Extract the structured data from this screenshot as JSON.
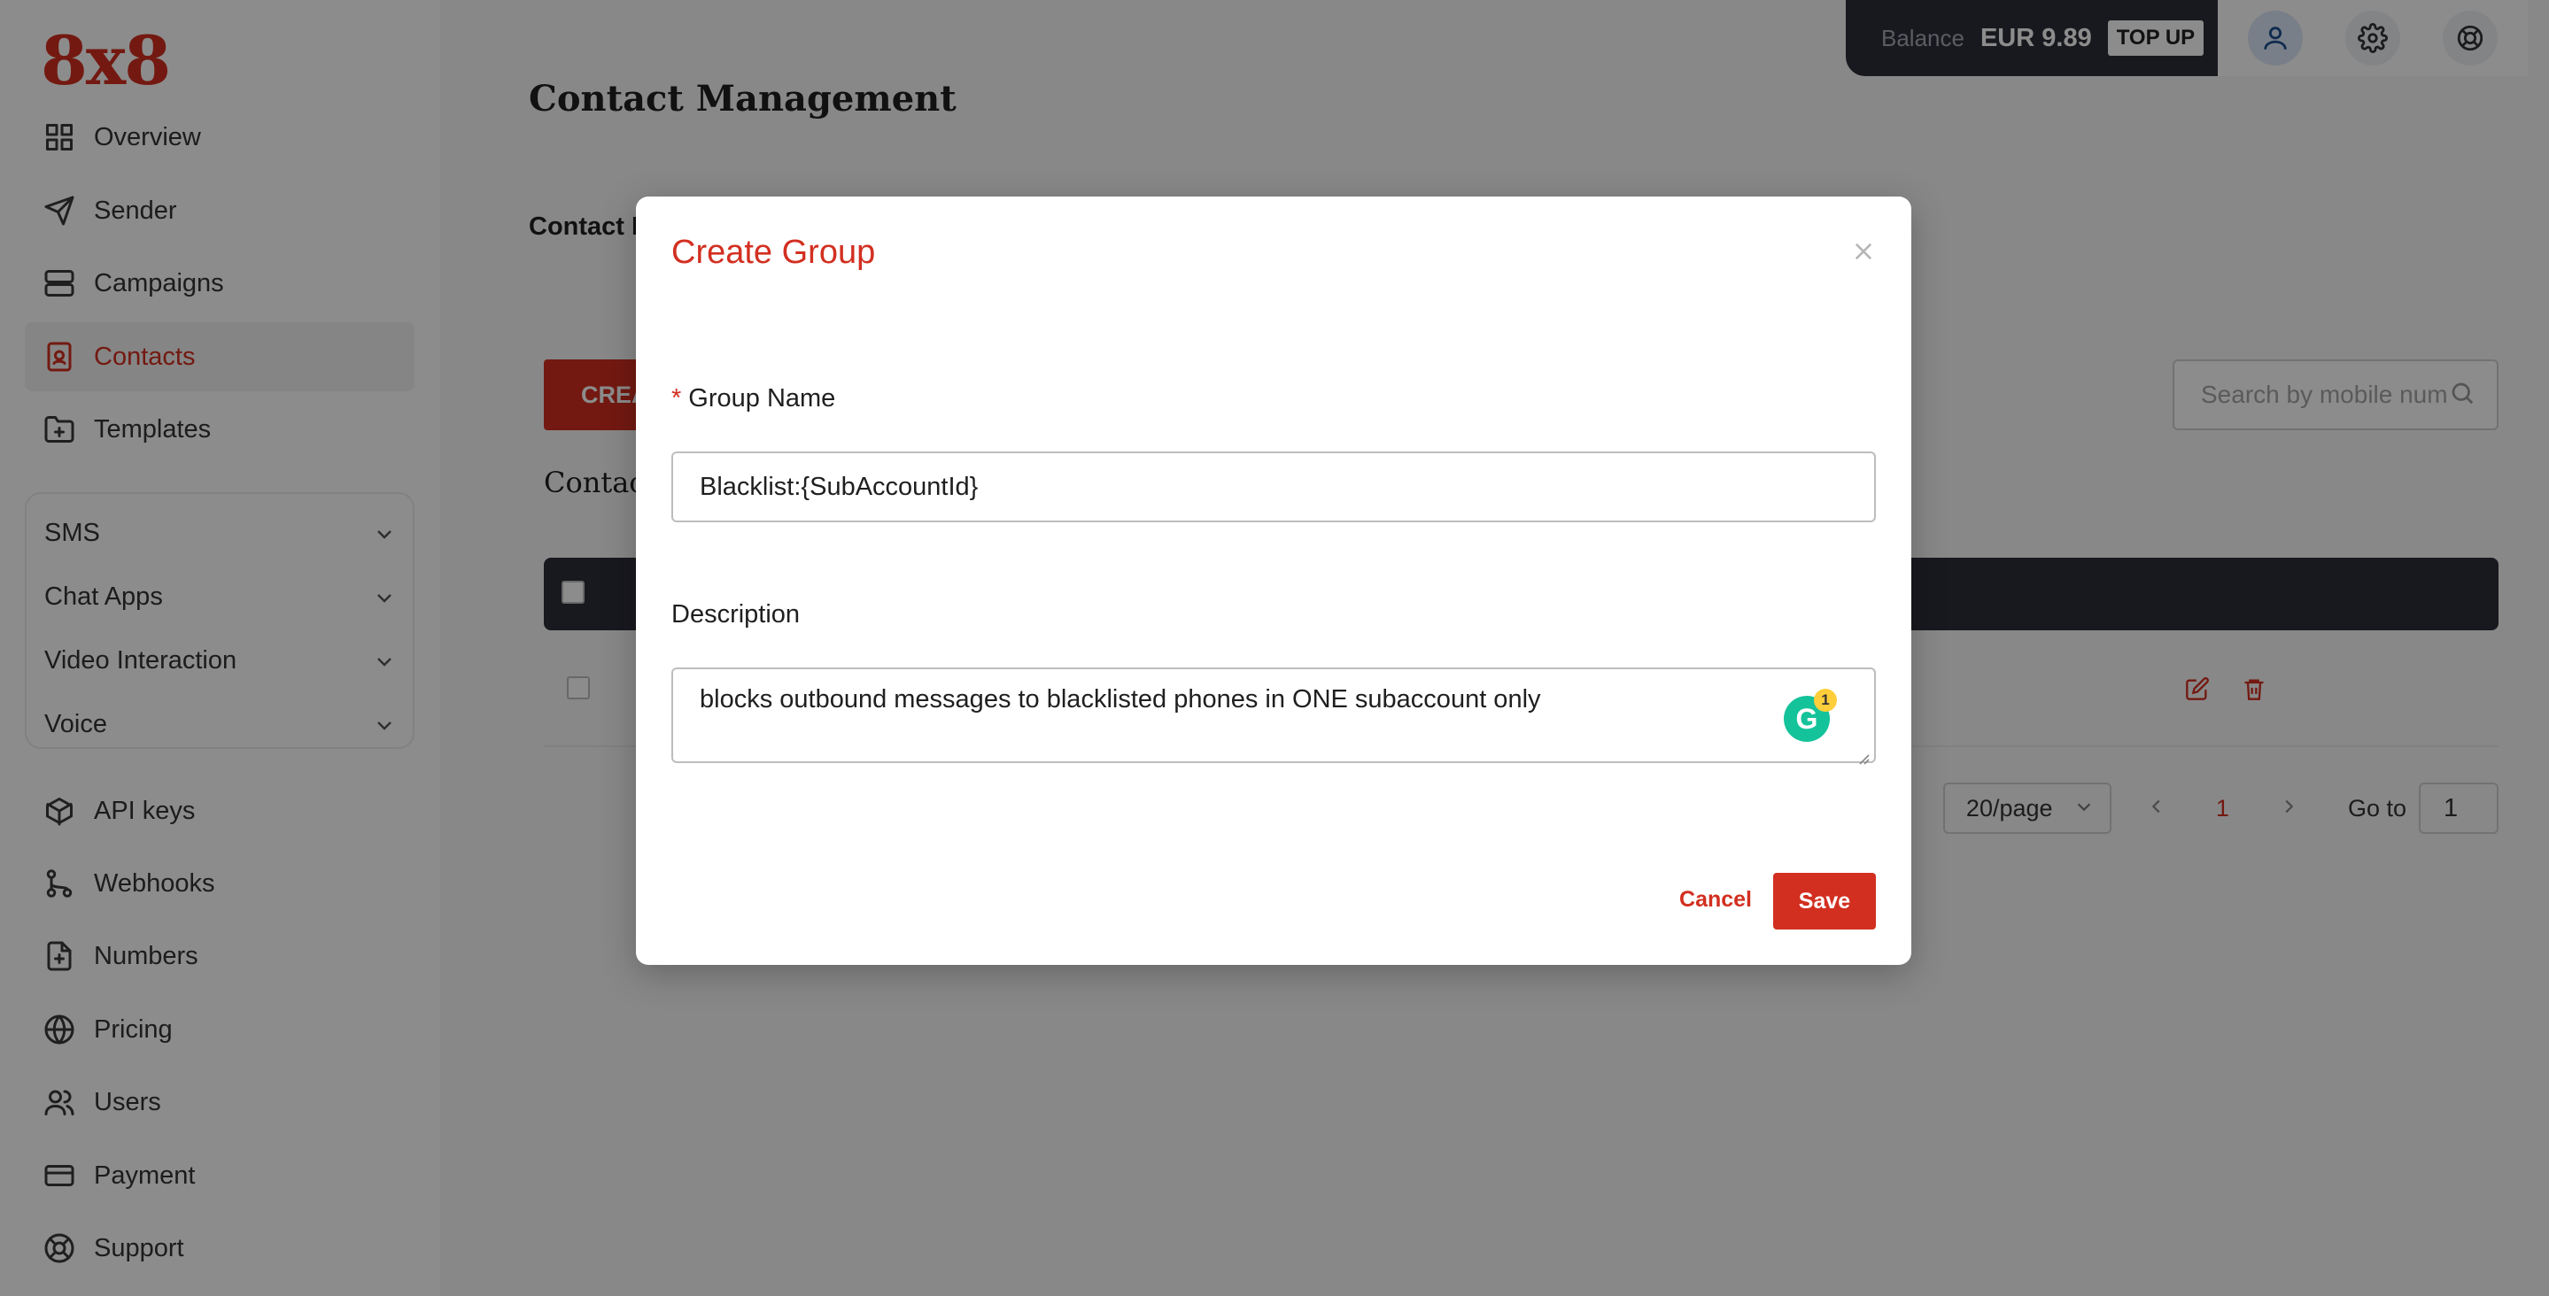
{
  "brand": {
    "logo_text": "8x8",
    "accent": "#d22f20",
    "dark": "#2d2d3a"
  },
  "sidebar": {
    "items": [
      {
        "label": "Overview",
        "icon": "grid-icon"
      },
      {
        "label": "Sender",
        "icon": "send-icon"
      },
      {
        "label": "Campaigns",
        "icon": "server-icon"
      },
      {
        "label": "Contacts",
        "icon": "contact-book-icon",
        "active": true
      },
      {
        "label": "Templates",
        "icon": "folder-plus-icon"
      }
    ],
    "groups": [
      {
        "label": "SMS"
      },
      {
        "label": "Chat Apps"
      },
      {
        "label": "Video Interaction"
      },
      {
        "label": "Voice"
      }
    ],
    "bottom_items": [
      {
        "label": "API keys",
        "icon": "cube-icon"
      },
      {
        "label": "Webhooks",
        "icon": "git-branch-icon"
      },
      {
        "label": "Numbers",
        "icon": "file-plus-icon"
      },
      {
        "label": "Pricing",
        "icon": "globe-icon"
      },
      {
        "label": "Users",
        "icon": "users-icon"
      },
      {
        "label": "Payment",
        "icon": "credit-card-icon"
      },
      {
        "label": "Support",
        "icon": "lifebuoy-icon"
      }
    ]
  },
  "topbar": {
    "balance_label": "Balance",
    "balance_amount": "EUR 9.89",
    "topup_label": "TOP UP"
  },
  "main": {
    "title": "Contact Management",
    "subtab": "Contact L",
    "create_button": "CREA",
    "search_placeholder": "Search by mobile num",
    "section_label": "Contac"
  },
  "pagination": {
    "page_size": "20/page",
    "current_page": "1",
    "goto_label": "Go to",
    "goto_value": "1"
  },
  "modal": {
    "title": "Create Group",
    "group_name_label": "Group Name",
    "group_name_value": "Blacklist:{SubAccountId}",
    "description_label": "Description",
    "description_value": "blocks outbound messages to blacklisted phones in ONE subaccount only",
    "grammarly_count": "1",
    "cancel_label": "Cancel",
    "save_label": "Save"
  }
}
